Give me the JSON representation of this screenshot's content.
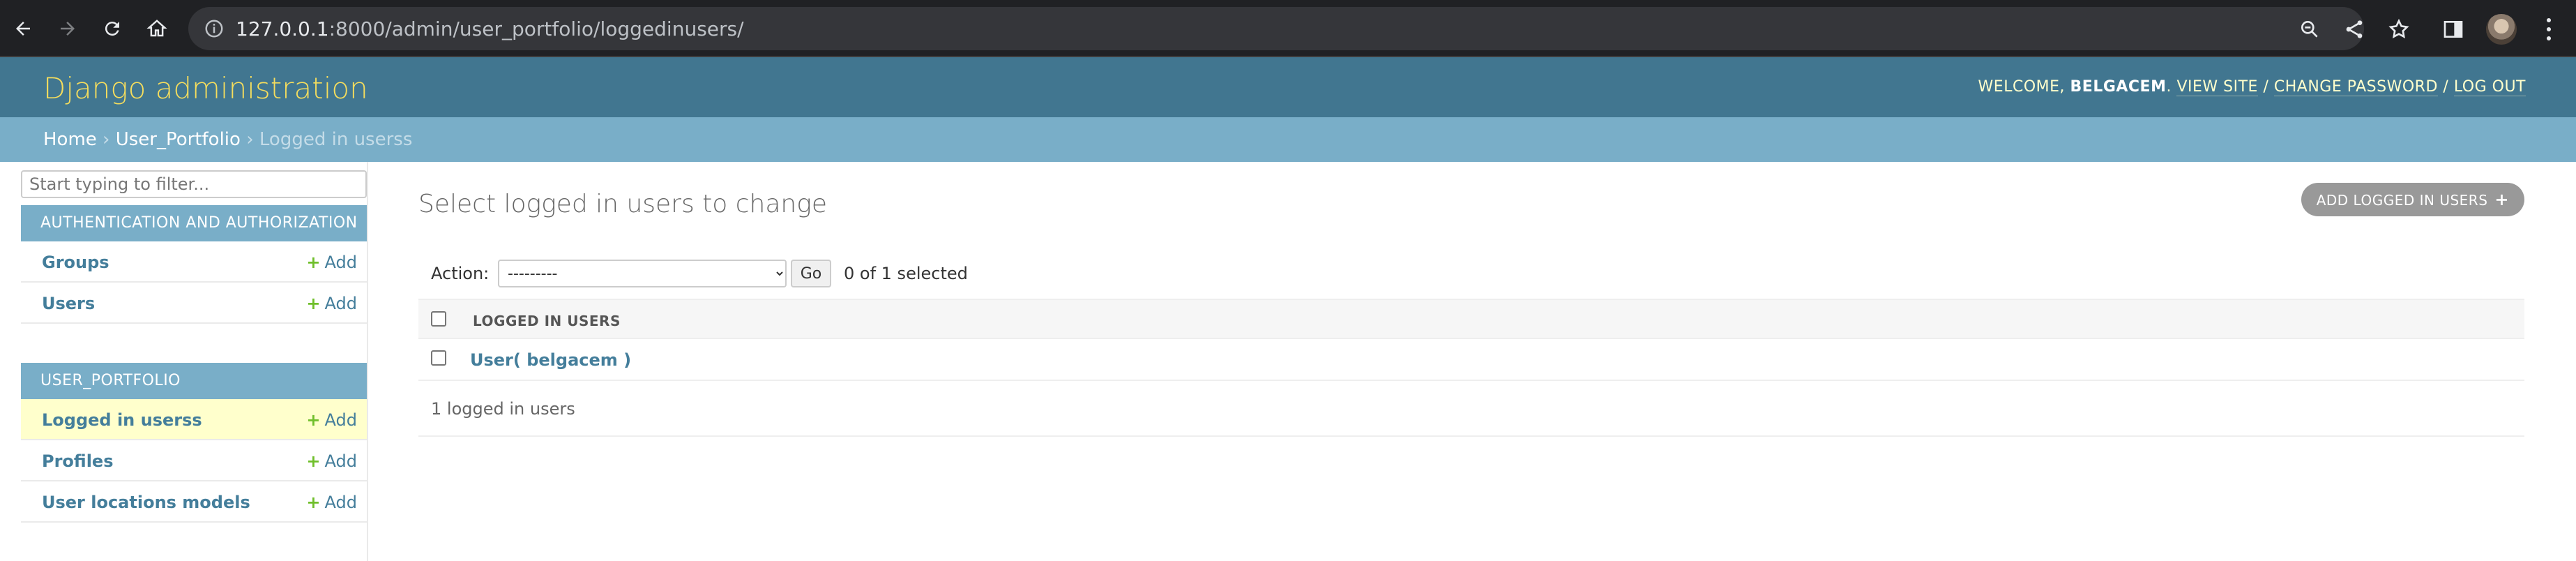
{
  "browser": {
    "url_host": "127.0.0.1",
    "url_rest": ":8000/admin/user_portfolio/loggedinusers/"
  },
  "header": {
    "branding": "Django administration",
    "welcome": "WELCOME,",
    "username": "BELGACEM",
    "view_site": "VIEW SITE",
    "change_password": "CHANGE PASSWORD",
    "log_out": "LOG OUT",
    "separator": "/"
  },
  "breadcrumbs": {
    "home": "Home",
    "app": "User_Portfolio",
    "current": "Logged in userss",
    "separator": "›"
  },
  "sidebar": {
    "filter_placeholder": "Start typing to filter...",
    "modules": [
      {
        "caption": "Authentication and Authorization",
        "models": [
          {
            "label": "Groups",
            "add": "Add"
          },
          {
            "label": "Users",
            "add": "Add"
          }
        ]
      },
      {
        "caption": "User_Portfolio",
        "models": [
          {
            "label": "Logged in userss",
            "add": "Add",
            "current": true
          },
          {
            "label": "Profiles",
            "add": "Add"
          },
          {
            "label": "User locations models",
            "add": "Add"
          }
        ]
      }
    ]
  },
  "main": {
    "title": "Select logged in users to change",
    "add_button": "Add logged in users",
    "action_label": "Action:",
    "action_selected": "---------",
    "go_label": "Go",
    "selection_count": "0 of 1 selected",
    "column_header": "Logged in users",
    "rows": [
      {
        "label": "User( belgacem )"
      }
    ],
    "paginator": "1 logged in users"
  },
  "colors": {
    "header_bg": "#417690",
    "branding": "#f5dd5d",
    "breadcrumb_bg": "#79aec8",
    "link": "#447e9b",
    "add_plus": "#70bf2b",
    "current_row": "#ffffcc"
  }
}
